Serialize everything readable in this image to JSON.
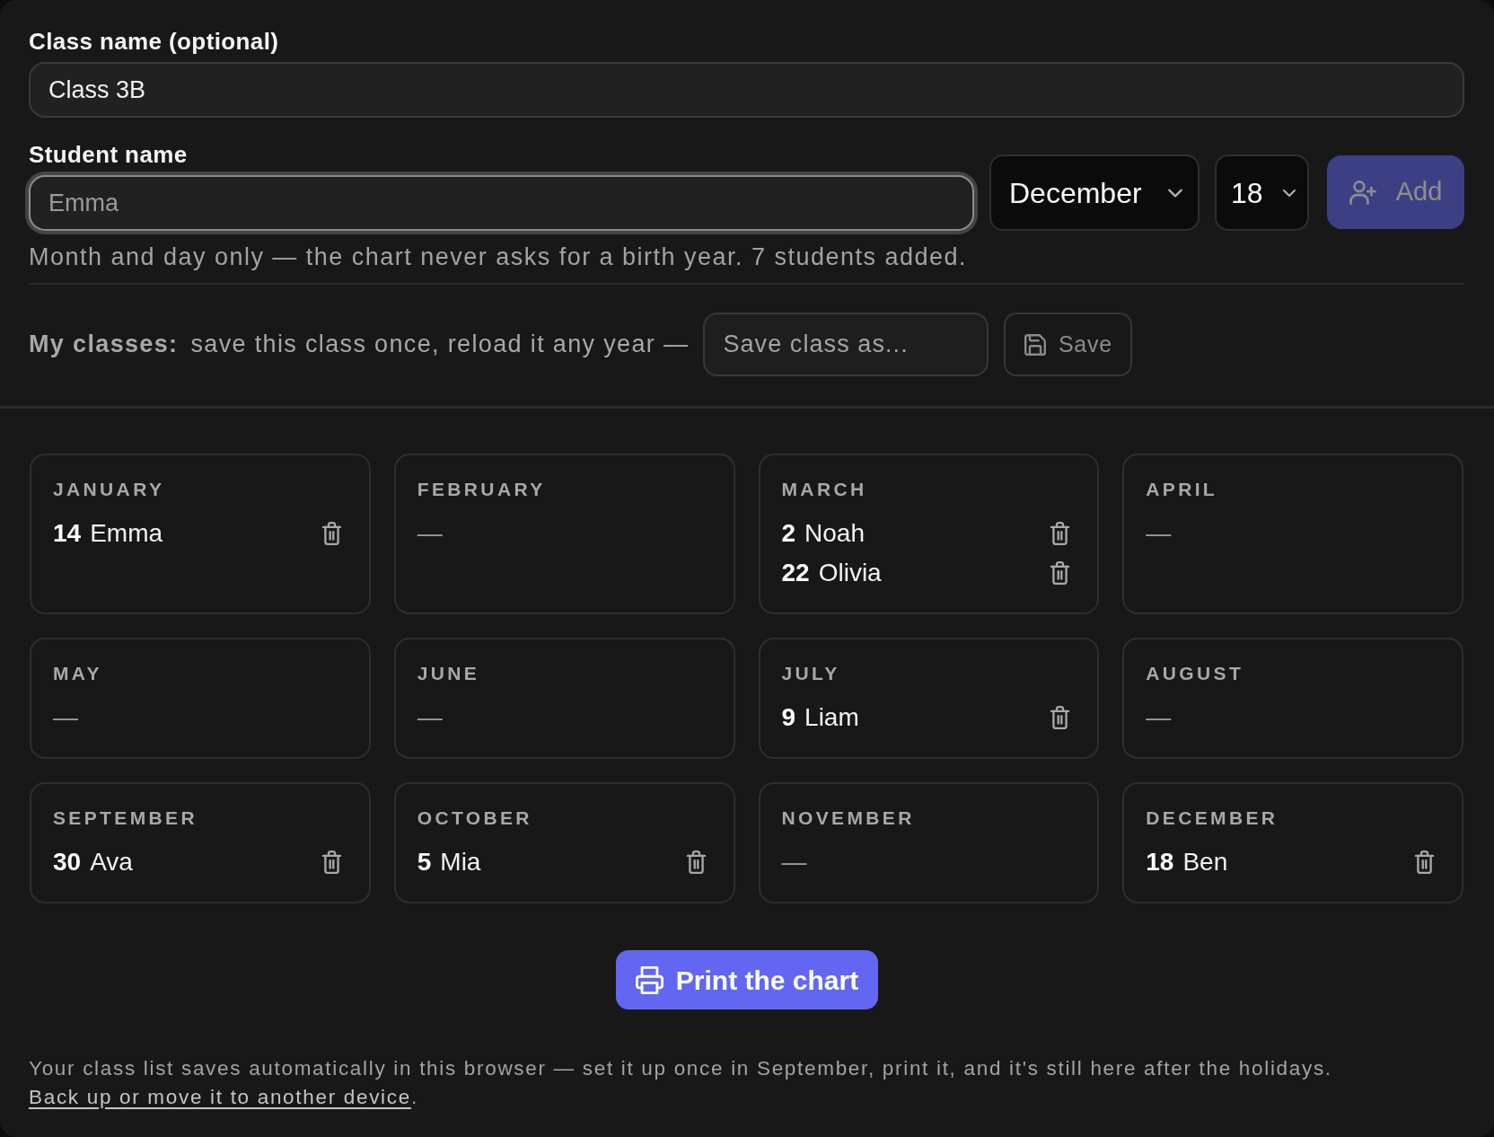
{
  "class_name": {
    "label": "Class name (optional)",
    "value": "Class 3B"
  },
  "student_name": {
    "label": "Student name",
    "placeholder": "Emma",
    "focused": true
  },
  "month_select": {
    "value": "December"
  },
  "day_select": {
    "value": "18"
  },
  "add_button": {
    "label": "Add",
    "disabled": true
  },
  "help_text": "Month and day only — the chart never asks for a birth year. 7 students added.",
  "my_classes": {
    "title": "My classes:",
    "text": "save this class once, reload it any year —",
    "name_field": {
      "placeholder": "Save class as..."
    },
    "save_button": {
      "label": "Save",
      "disabled": true
    }
  },
  "months": [
    {
      "name": "JANUARY",
      "students": [
        {
          "day": "14",
          "name": "Emma"
        }
      ]
    },
    {
      "name": "FEBRUARY",
      "empty_mark": "—"
    },
    {
      "name": "MARCH",
      "students": [
        {
          "day": "2",
          "name": "Noah"
        },
        {
          "day": "22",
          "name": "Olivia"
        }
      ]
    },
    {
      "name": "APRIL",
      "empty_mark": "—"
    },
    {
      "name": "MAY",
      "empty_mark": "—"
    },
    {
      "name": "JUNE",
      "empty_mark": "—"
    },
    {
      "name": "JULY",
      "students": [
        {
          "day": "9",
          "name": "Liam"
        }
      ]
    },
    {
      "name": "AUGUST",
      "empty_mark": "—"
    },
    {
      "name": "SEPTEMBER",
      "students": [
        {
          "day": "30",
          "name": "Ava"
        }
      ]
    },
    {
      "name": "OCTOBER",
      "students": [
        {
          "day": "5",
          "name": "Mia"
        }
      ]
    },
    {
      "name": "NOVEMBER",
      "empty_mark": "—"
    },
    {
      "name": "DECEMBER",
      "students": [
        {
          "day": "18",
          "name": "Ben"
        }
      ]
    }
  ],
  "print_button": {
    "label": "Print the chart"
  },
  "footer": {
    "text": "Your class list saves automatically in this browser — set it up once in September, print it, and it's still here after the holidays.",
    "link": "Back up or move it to another device",
    "end": "."
  }
}
